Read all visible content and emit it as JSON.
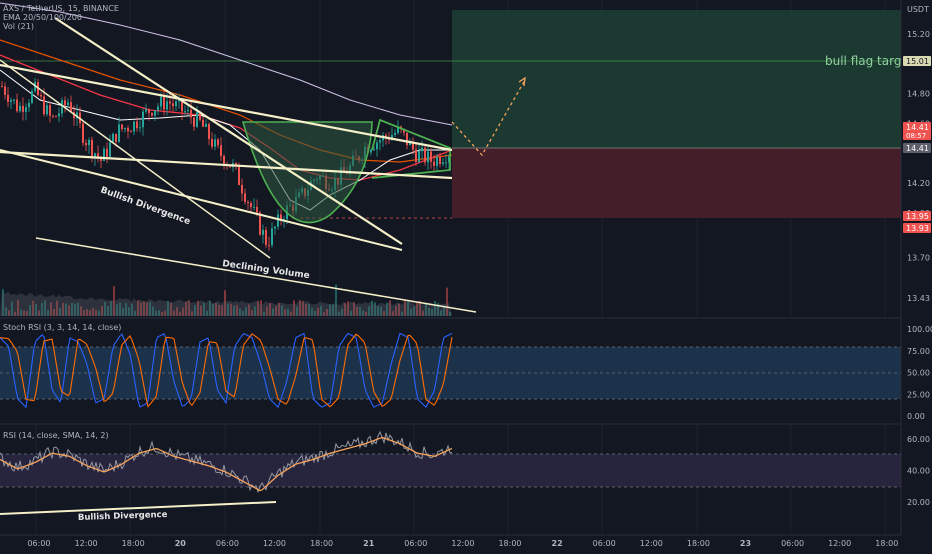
{
  "legend": {
    "symbol": "AXS / TetherUS, 15, BINANCE",
    "ema": "EMA 20/50/100/200",
    "vol": "Vol (21)",
    "stoch": "Stoch RSI (3, 3, 14, 14, close)",
    "rsi": "RSI (14, close, SMA, 14, 2)"
  },
  "currency": "USDT",
  "annotations": {
    "bull_flag_target": "bull flag target",
    "bullish_divergence_price": "Bullish Divergence",
    "declining_volume": "Declining Volume",
    "bullish_divergence_rsi": "Bullish Divergence"
  },
  "chart_data": [
    {
      "type": "candlestick",
      "panel": "price",
      "title": "AXS / TetherUS, 15, BINANCE",
      "ylabel": "USDT",
      "ylim": [
        13.35,
        15.4
      ],
      "y_ticks": [
        15.2,
        14.8,
        14.6,
        14.2,
        14.0,
        13.7,
        13.43
      ],
      "price_labels": [
        {
          "value": "15.01",
          "color": "#d1d4dc"
        },
        {
          "value": "14.41",
          "sub": "08:57",
          "color": "#ef5350"
        },
        {
          "value": "14.41",
          "color": "#b2b5be"
        },
        {
          "value": "13.95",
          "color": "#ef5350"
        },
        {
          "value": "13.93",
          "color": "#ef5350"
        }
      ],
      "price_approx": [
        14.85,
        14.7,
        14.82,
        14.62,
        14.75,
        14.5,
        14.35,
        14.55,
        14.6,
        14.7,
        14.75,
        14.68,
        14.6,
        14.42,
        14.3,
        14.05,
        13.8,
        14.0,
        14.1,
        14.25,
        14.2,
        14.3,
        14.45,
        14.5,
        14.55,
        14.4,
        14.35,
        14.41
      ],
      "position": {
        "entry": 14.41,
        "target": 15.35,
        "stop": 13.95
      },
      "target_line": 15.01,
      "series": [
        {
          "name": "EMA 20",
          "color": "#ffffff"
        },
        {
          "name": "EMA 50",
          "color": "#f23645"
        },
        {
          "name": "EMA 100",
          "color": "#e65100"
        },
        {
          "name": "EMA 200",
          "color": "#d1c4e9"
        }
      ]
    },
    {
      "type": "line",
      "panel": "stoch_rsi",
      "title": "Stoch RSI (3, 3, 14, 14, close)",
      "ylim": [
        -5,
        105
      ],
      "y_ticks": [
        "100.00",
        "75.00",
        "50.00",
        "25.00",
        "0.00"
      ],
      "bands": [
        80,
        50,
        20
      ],
      "series": [
        {
          "name": "K",
          "color": "#2962ff"
        },
        {
          "name": "D",
          "color": "#ff6d00"
        }
      ]
    },
    {
      "type": "line",
      "panel": "rsi",
      "title": "RSI (14, close, SMA, 14, 2)",
      "ylim": [
        10,
        72
      ],
      "y_ticks": [
        "60.00",
        "40.00",
        "20.00"
      ],
      "bands": [
        70,
        50,
        30
      ],
      "series": [
        {
          "name": "RSI",
          "color": "#9598a1"
        },
        {
          "name": "RSI-based MA",
          "color": "#f7a35c"
        }
      ]
    }
  ],
  "time_axis": [
    "06:00",
    "12:00",
    "18:00",
    "20",
    "06:00",
    "12:00",
    "18:00",
    "21",
    "06:00",
    "12:00",
    "18:00",
    "22",
    "06:00",
    "12:00",
    "18:00",
    "23",
    "06:00",
    "12:00",
    "18:00"
  ]
}
